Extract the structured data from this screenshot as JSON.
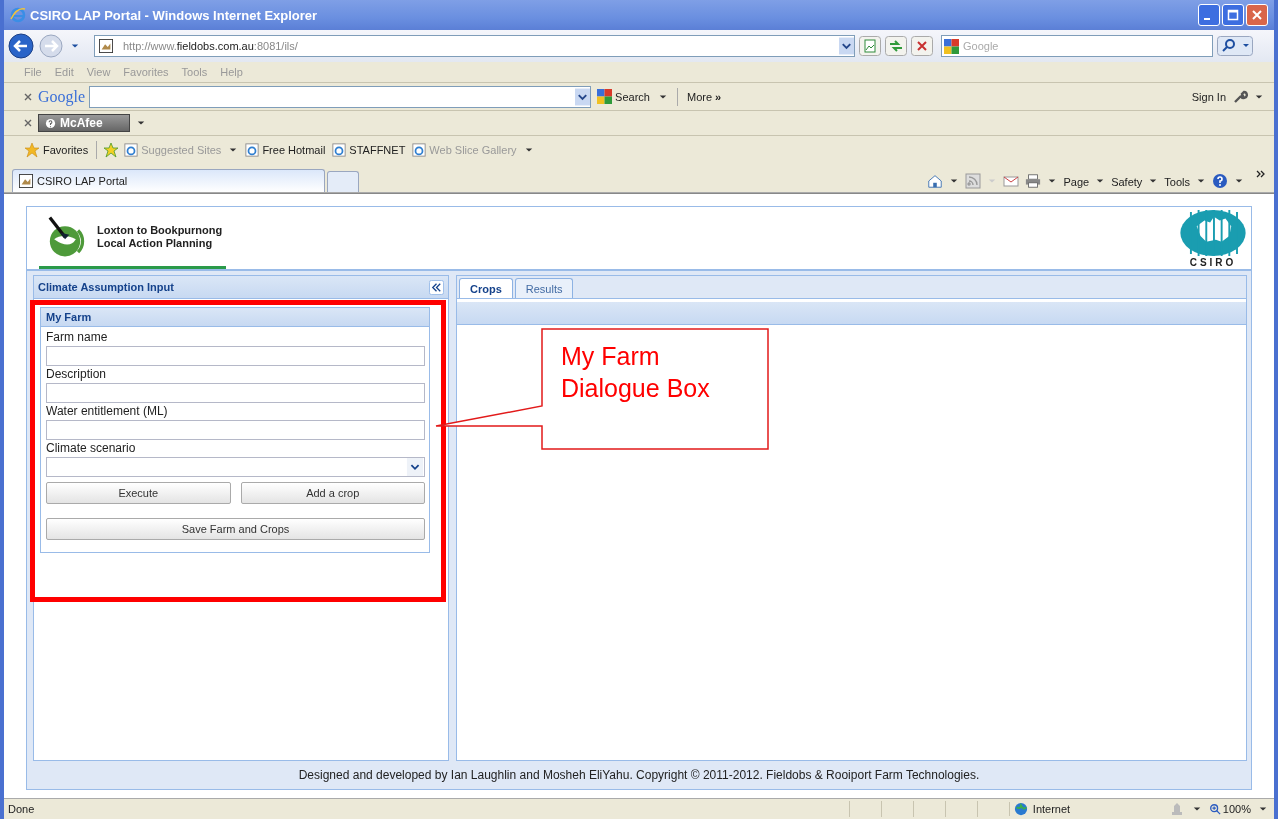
{
  "window": {
    "title": "CSIRO LAP Portal - Windows Internet Explorer"
  },
  "address_bar": {
    "url_prefix": "http://www.",
    "url_domain": "fieldobs.com.au",
    "url_suffix": ":8081/ils/",
    "search_placeholder": "Google"
  },
  "menu": [
    "File",
    "Edit",
    "View",
    "Favorites",
    "Tools",
    "Help"
  ],
  "google_toolbar": {
    "brand": "Google",
    "search": "Search",
    "more": "More",
    "more_glyph": "»",
    "sign_in": "Sign In"
  },
  "mcafee_toolbar": {
    "brand": "McAfee"
  },
  "favorites_bar": {
    "label": "Favorites",
    "items": [
      {
        "label": "Suggested Sites",
        "disabled": true,
        "dropdown": true
      },
      {
        "label": "Free Hotmail",
        "disabled": false,
        "dropdown": false
      },
      {
        "label": "STAFFNET",
        "disabled": false,
        "dropdown": false
      },
      {
        "label": "Web Slice Gallery",
        "disabled": true,
        "dropdown": true
      }
    ]
  },
  "browser_tabs": [
    {
      "label": "CSIRO LAP Portal",
      "selected": true
    }
  ],
  "command_bar": [
    "Page",
    "Safety",
    "Tools"
  ],
  "header": {
    "title_lines": [
      "Loxton to Bookpurnong",
      "Local Action Planning"
    ],
    "org": "CSIRO"
  },
  "left_panel": {
    "title": "Climate Assumption Input",
    "form": {
      "title": "My Farm",
      "fields": [
        {
          "label": "Farm name",
          "kind": "text"
        },
        {
          "label": "Description",
          "kind": "text"
        },
        {
          "label": "Water entitlement (ML)",
          "kind": "text"
        },
        {
          "label": "Climate scenario",
          "kind": "select"
        }
      ],
      "buttons": [
        "Execute",
        "Add a crop"
      ],
      "save_button": "Save Farm and Crops"
    }
  },
  "right_tabs": [
    {
      "label": "Crops",
      "selected": true
    },
    {
      "label": "Results",
      "selected": false
    }
  ],
  "footer": "Designed and developed by Ian Laughlin and Mosheh EliYahu. Copyright © 2011-2012. Fieldobs & Rooiport Farm Technologies.",
  "annotation": {
    "lines": [
      "My Farm",
      "Dialogue Box"
    ]
  },
  "status_bar": {
    "text": "Done",
    "zone": "Internet",
    "zoom": "100%"
  }
}
